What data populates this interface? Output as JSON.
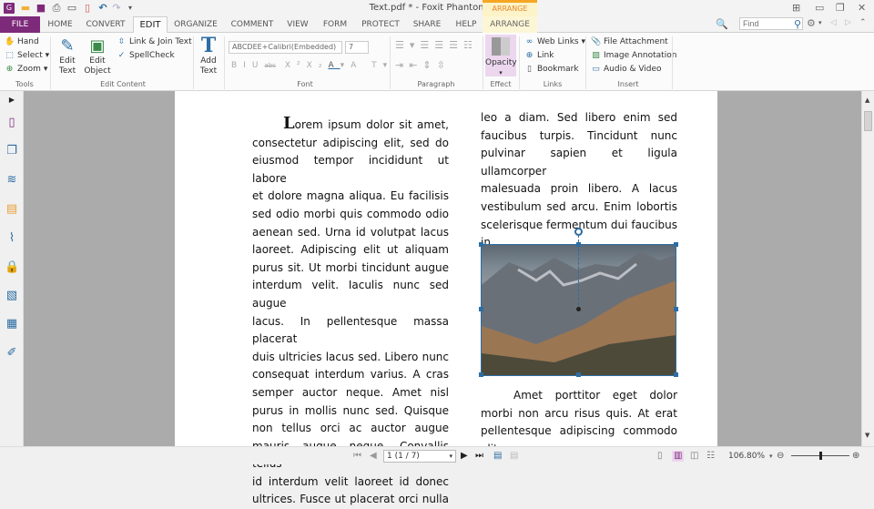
{
  "window": {
    "title": "Text.pdf * - Foxit PhantomPDF",
    "context_tab_group": "ARRANGE"
  },
  "quick_access": [
    "app-logo",
    "open",
    "save",
    "print",
    "scan",
    "create-pdf",
    "undo",
    "redo",
    "customize"
  ],
  "tabs": [
    {
      "label": "FILE"
    },
    {
      "label": "HOME"
    },
    {
      "label": "CONVERT"
    },
    {
      "label": "EDIT",
      "active": true
    },
    {
      "label": "ORGANIZE"
    },
    {
      "label": "COMMENT"
    },
    {
      "label": "VIEW"
    },
    {
      "label": "FORM"
    },
    {
      "label": "PROTECT"
    },
    {
      "label": "SHARE"
    },
    {
      "label": "HELP"
    },
    {
      "label": "ARRANGE",
      "contextual": true
    }
  ],
  "search": {
    "placeholder": "Find"
  },
  "ribbon": {
    "tools": {
      "label": "Tools",
      "hand": "Hand",
      "select": "Select",
      "zoom": "Zoom"
    },
    "edit_content": {
      "label": "Edit Content",
      "edit_text": "Edit Text",
      "edit_object": "Edit Object",
      "link_join": "Link & Join Text",
      "spellcheck": "SpellCheck"
    },
    "add_text": "Add Text",
    "font": {
      "label": "Font",
      "family": "ABCDEE+Calibri(Embedded)",
      "size": "7"
    },
    "paragraph": {
      "label": "Paragraph"
    },
    "effect": {
      "label": "Effect",
      "opacity": "Opacity"
    },
    "links": {
      "label": "Links",
      "web_links": "Web Links",
      "link": "Link",
      "bookmark": "Bookmark"
    },
    "insert": {
      "label": "Insert",
      "file_attachment": "File Attachment",
      "image_annotation": "Image Annotation",
      "audio_video": "Audio & Video"
    }
  },
  "document": {
    "col1_first": "orem ipsum dolor sit amet,",
    "col1_dropcap": "L",
    "col1_lines": [
      "consectetur adipiscing elit, sed do",
      "eiusmod tempor incididunt ut labore",
      "et dolore magna aliqua. Eu facilisis",
      "sed odio morbi quis commodo odio",
      "aenean sed. Urna id volutpat lacus",
      "laoreet. Adipiscing elit ut aliquam",
      "purus sit. Ut morbi tincidunt augue",
      "interdum velit. Iaculis nunc sed augue",
      "lacus. In pellentesque massa placerat",
      "duis ultricies lacus sed. Libero nunc",
      "consequat interdum varius. A cras",
      "semper auctor neque. Amet nisl",
      "purus in mollis nunc sed. Quisque",
      "non tellus orci ac auctor augue",
      "mauris augue neque. Convallis tellus",
      "id interdum velit laoreet id donec",
      "ultrices. Fusce ut placerat orci nulla"
    ],
    "col2_top": [
      "leo a diam. Sed libero enim sed",
      "faucibus turpis. Tincidunt nunc",
      "pulvinar sapien et ligula ullamcorper",
      "malesuada proin libero. A lacus",
      "vestibulum sed arcu. Enim lobortis",
      "scelerisque fermentum dui faucibus"
    ],
    "col2_top_last": "in.",
    "col2_bottom": [
      "Amet porttitor eget dolor",
      "morbi non arcu risus quis. At erat",
      "pellentesque adipiscing commodo elit"
    ],
    "image_alt": "mountain landscape photo (selected)"
  },
  "status": {
    "page_field": "1 (1 / 7)",
    "zoom": "106.80%",
    "zoom_slider_fraction": 0.5
  }
}
